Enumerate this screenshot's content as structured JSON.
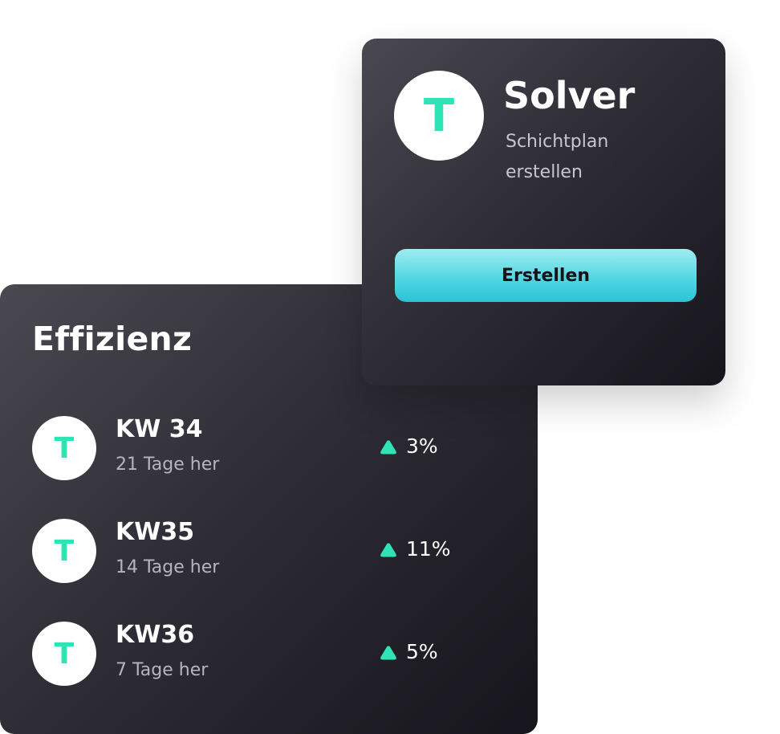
{
  "colors": {
    "accent": "#2ee3b6",
    "card_dark": "#1c1a21",
    "button_cyan": "#52d7e3"
  },
  "efficiency": {
    "title": "Effizienz",
    "rows": [
      {
        "avatar": "T",
        "title": "KW 34",
        "subtitle": "21 Tage her",
        "trend_icon": "triangle-up-icon",
        "value": "3%"
      },
      {
        "avatar": "T",
        "title": "KW35",
        "subtitle": "14 Tage her",
        "trend_icon": "triangle-up-icon",
        "value": "11%"
      },
      {
        "avatar": "T",
        "title": "KW36",
        "subtitle": "7 Tage her",
        "trend_icon": "triangle-up-icon",
        "value": "5%"
      }
    ]
  },
  "solver": {
    "avatar": "T",
    "title": "Solver",
    "subtitle": "Schichtplan erstellen",
    "button_label": "Erstellen"
  }
}
